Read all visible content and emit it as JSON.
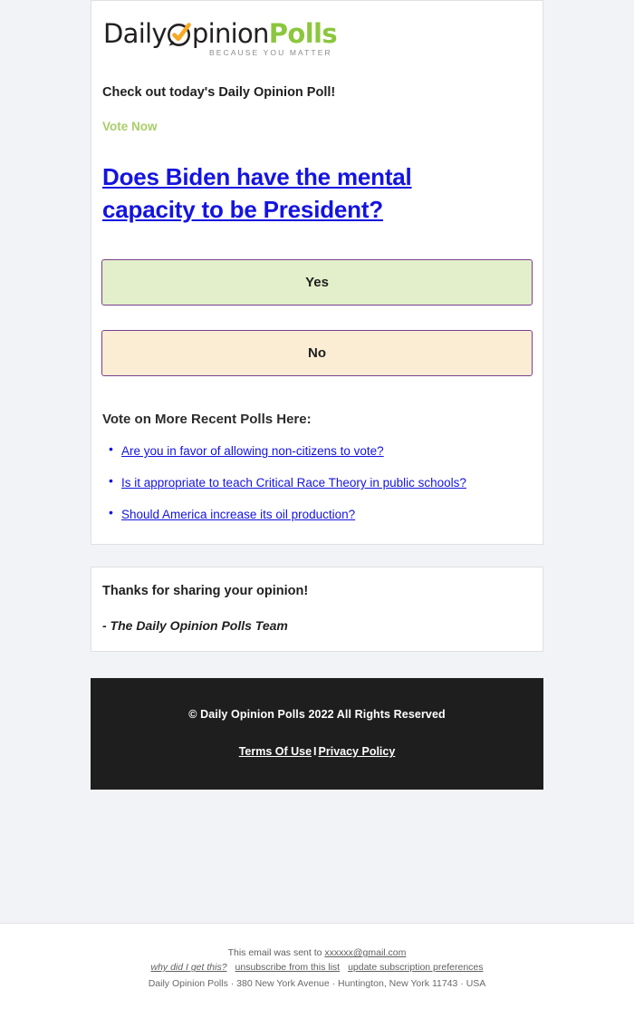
{
  "brand": {
    "logo_part1": "Daily",
    "logo_o": "O",
    "logo_part2": "pinion",
    "logo_part3": "Polls",
    "tagline": "BECAUSE YOU MATTER",
    "green": "#8cc63f",
    "dark": "#231f20",
    "check_orange": "#f7a823"
  },
  "email": {
    "intro": "Check out today's Daily Opinion Poll!",
    "vote_now": "Vote Now",
    "question": "Does Biden have the mental capacity to be President?",
    "answers": [
      {
        "label": "Yes",
        "bg": "#e3efca",
        "border": "#7b3f8f"
      },
      {
        "label": "No",
        "bg": "#fbecd4",
        "border": "#7b3f8f"
      }
    ],
    "more_heading": "Vote on More Recent Polls Here:",
    "more_polls": [
      "Are you in favor of allowing non-citizens to vote?",
      "Is it appropriate to teach Critical Race Theory in public schools?",
      "Should America increase its oil production?"
    ],
    "link_color": "#1414e0"
  },
  "thanks": {
    "line1": "Thanks for sharing your opinion!",
    "line2": "- The Daily Opinion Polls Team"
  },
  "footer": {
    "copyright": "© Daily Opinion Polls 2022 All Rights Reserved",
    "terms_label": "Terms Of Use",
    "separator": "I",
    "privacy_label": "Privacy Policy",
    "bg": "#1e1e1e"
  },
  "unsubscribe": {
    "sent_to_prefix": "This email was sent to",
    "recipient_email": "xxxxxx@gmail.com",
    "why_label": "why did I get this?",
    "unsubscribe_label": "unsubscribe from this list",
    "update_label": "update subscription preferences",
    "address": "Daily Opinion Polls · 380 New York Avenue · Huntington, New York 11743 · USA"
  }
}
